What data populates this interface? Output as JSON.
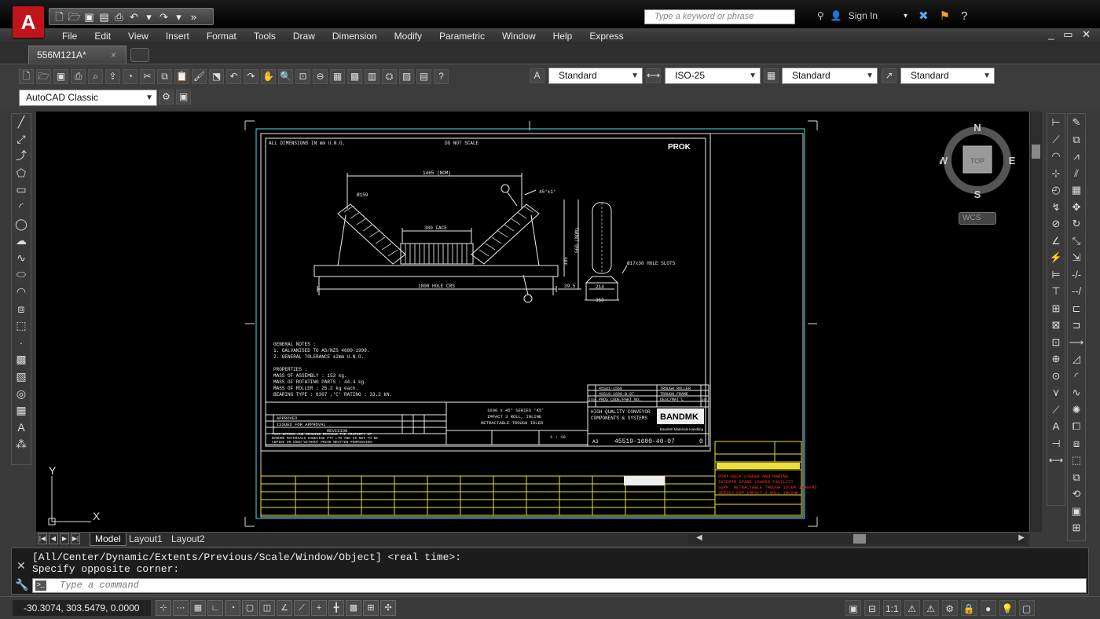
{
  "app": {
    "logo": "A",
    "search_placeholder": "Type a keyword or phrase",
    "sign_in": "Sign In"
  },
  "menu": [
    "File",
    "Edit",
    "View",
    "Insert",
    "Format",
    "Tools",
    "Draw",
    "Dimension",
    "Modify",
    "Parametric",
    "Window",
    "Help",
    "Express"
  ],
  "doc_tab": {
    "name": "556M121A*",
    "close": "×"
  },
  "toolbar": {
    "text_style": "Standard",
    "dim_style": "ISO-25",
    "table_style": "Standard",
    "mleader_style": "Standard"
  },
  "workspace": "AutoCAD Classic",
  "viewcube": {
    "n": "N",
    "s": "S",
    "e": "E",
    "w": "W",
    "face": "TOP",
    "wcs": "WCS"
  },
  "ucs": {
    "x": "X",
    "y": "Y"
  },
  "layout_tabs": [
    "Model",
    "Layout1",
    "Layout2"
  ],
  "command": {
    "line1": "[All/Center/Dynamic/Extents/Previous/Scale/Window/Object] <real time>:",
    "line2": "Specify opposite corner:",
    "placeholder": "Type a command"
  },
  "status": {
    "coords": "-30.3074, 303.5479, 0.0000",
    "scale": "1:1"
  },
  "drawing": {
    "dims_note": "ALL DIMENSIONS IN mm U.N.O.",
    "no_scale": "DO NOT SCALE",
    "logo": "PROK",
    "d1": "1465 (NOM)",
    "d2": "380 FACE",
    "d3": "Ø159",
    "d4": "1800 HOLE CRS",
    "d5": "39.5",
    "d6": "214",
    "d7": "350",
    "d8": "45°±1°",
    "d9": "Ø17x30 HOLE SLOTS",
    "d10": "385",
    "d11": "560 (NOM)",
    "notes": [
      "GENERAL NOTES :",
      "1. GALVANISED TO AS/NZS 4680-1999.",
      "2. GENERAL TOLERANCE ±2mm U.N.O."
    ],
    "props": [
      "PROPERTIES :",
      "MASS OF ASSEMBLY : 153 kg.",
      "MASS OF ROTATING PARTS : 44.4 kg.",
      "MASS OF ROLLER : 25.2 kg each.",
      "BEARING TYPE : 6307 ,'C' RATING : 33.2 kN."
    ],
    "title": [
      "1600 x 45° SERIES 'K5'",
      "IMPACT 3 ROLL, INLINE",
      "RETRACTABLE TROUGH IDLER"
    ],
    "rev": [
      "APPROVED",
      "ISSUED FOR APPROVAL",
      "REVISION"
    ],
    "bom": [
      "45SU1-1560",
      "TROUGH ROLLER",
      "4S519-1600-B-07",
      "TROUGH FRAME",
      "ITEM",
      "PROS CODE/PART No.",
      "DESC/MAT'L",
      "QTY"
    ],
    "company": [
      "HIGH QUALITY CONVEYOR",
      "COMPONENTS & SYSTEMS"
    ],
    "brand": "BANDMK",
    "brand_sub": "Bandmk Materials Handling",
    "dwg_no": "45519-1600-40-07",
    "dwg_rev": "0",
    "sheet": "A3",
    "scale": "1 : 10",
    "red_block": [
      "PORT-BULK LOADER AND MARINE",
      "INTERIM SPARE LOADER FACILITY",
      "SUPP. RETRACTABLE TROUGH IDLER 1600x45",
      "SERIES K5P IMPACT 3 ROLL INLINE"
    ],
    "copyright": [
      "THIS DESIGN AND DRAWING REMAINS THE PROPERTY OF",
      "BANDMK MATERIALS HANDLING PTY LTD AND IS NOT TO BE",
      "COPIED OR USED WITHOUT PRIOR WRITTEN PERMISSION."
    ]
  }
}
